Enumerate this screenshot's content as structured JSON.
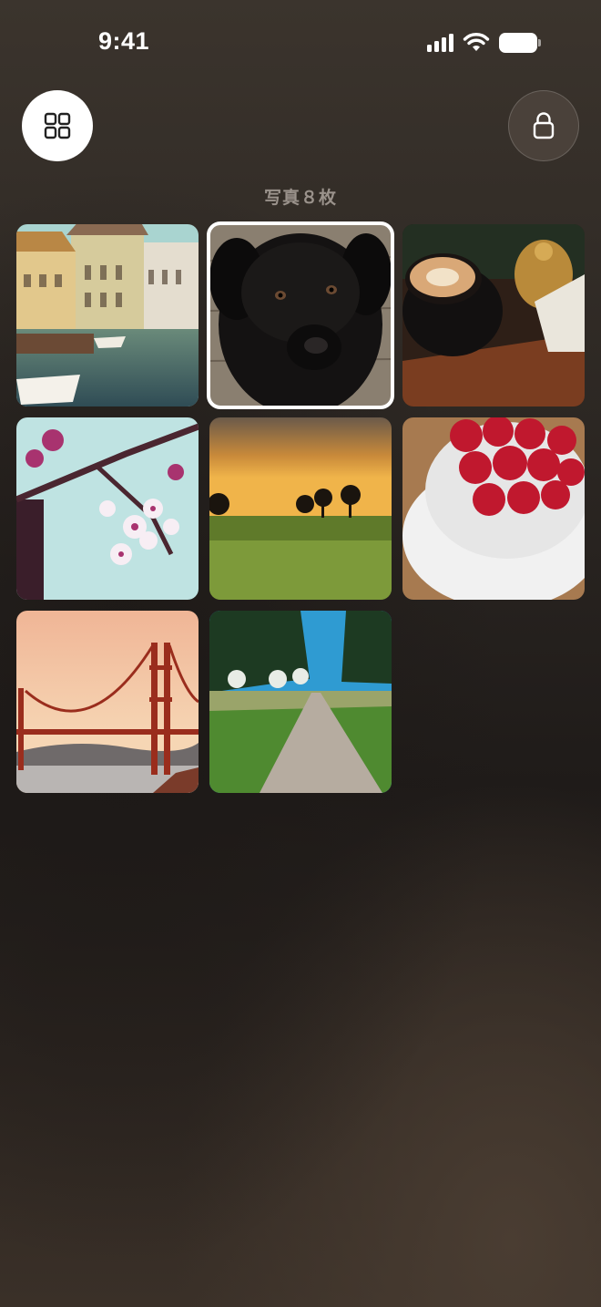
{
  "status_bar": {
    "time": "9:41"
  },
  "top_bar": {
    "grid_icon": "grid-icon",
    "lock_icon": "lock-icon"
  },
  "album": {
    "count_label": "写真８枚"
  },
  "photos": [
    {
      "name": "canal-town",
      "selected": false
    },
    {
      "name": "black-puppy",
      "selected": true
    },
    {
      "name": "latte-coffee",
      "selected": false
    },
    {
      "name": "cherry-blossom",
      "selected": false
    },
    {
      "name": "sunset-field",
      "selected": false
    },
    {
      "name": "raspberries-bowl",
      "selected": false
    },
    {
      "name": "golden-gate-bridge",
      "selected": false
    },
    {
      "name": "park-path",
      "selected": false
    }
  ]
}
